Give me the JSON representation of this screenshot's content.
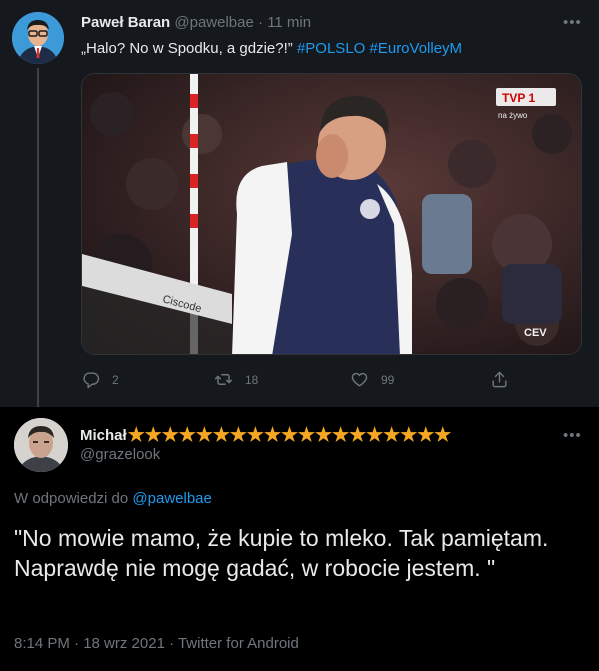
{
  "tweet1": {
    "name": "Paweł Baran",
    "handle": "@pawelbae",
    "separator": "·",
    "time": "11 min",
    "text": "„Halo? No w Spodku, a gdzie?!”",
    "hashtags": [
      "#POLSLO",
      "#EuroVolleyM"
    ],
    "media": {
      "broadcaster_logo": "TVP 1",
      "broadcaster_sub": "na żywo",
      "watermark": "CEV",
      "banner_text": "Ciscode"
    },
    "actions": {
      "reply_count": "2",
      "retweet_count": "18",
      "like_count": "99"
    },
    "icons": {
      "reply": "reply-icon",
      "retweet": "retweet-icon",
      "like": "heart-icon",
      "share": "share-icon",
      "more": "more-icon"
    }
  },
  "tweet2": {
    "name": "Michał",
    "stars": "★★★★★★★★★★★★★★★★★★★",
    "handle": "@grazelook",
    "reply_prefix": "W odpowiedzi do",
    "reply_mention": "@pawelbae",
    "text": "\"No mowie mamo, że kupie to mleko. Tak pamiętam. Naprawdę nie mogę gadać, w robocie jestem. \"",
    "timestamp": "8:14 PM · 18 wrz 2021 · Twitter for Android"
  },
  "colors": {
    "accent": "#1d9bf0",
    "star": "#f5a623",
    "muted": "#6e767d"
  }
}
